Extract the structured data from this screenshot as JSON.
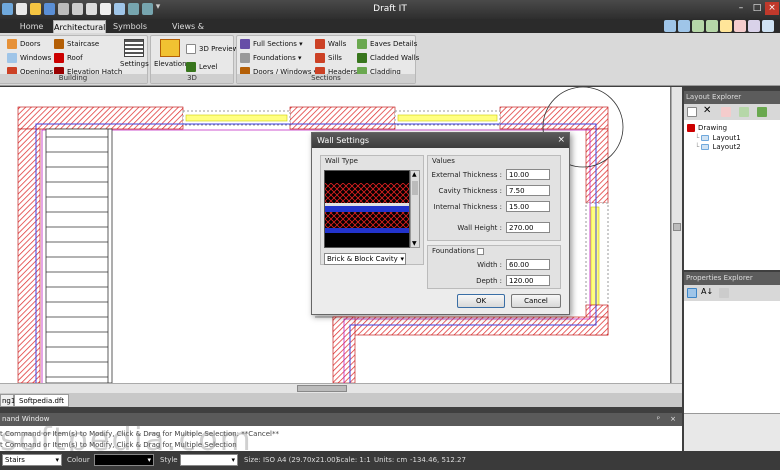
{
  "app_title": "Draft IT",
  "tabs": [
    "Home",
    "Architectural",
    "Symbols",
    "Views & Settings"
  ],
  "ribbon": {
    "building": {
      "caption": "Building",
      "doors": "Doors",
      "windows": "Windows",
      "openings": "Openings",
      "staircase": "Staircase",
      "roof": "Roof",
      "elevation_hatch": "Elevation Hatch",
      "settings": "Settings"
    },
    "three_d": {
      "caption": "3D",
      "elevation": "Elevation",
      "preview": "3D Preview",
      "level": "Level"
    },
    "sections": {
      "caption": "Sections",
      "full_sections": "Full Sections",
      "foundations": "Foundations",
      "doors_windows": "Doors / Windows",
      "walls": "Walls",
      "sills": "Sills",
      "headers": "Headers",
      "eaves_details": "Eaves Details",
      "cladded_walls": "Cladded Walls",
      "cladding": "Cladding"
    }
  },
  "dialog": {
    "title": "Wall Settings",
    "close": "×",
    "wall_type_legend": "Wall Type",
    "wall_type_value": "Brick & Block Cavity",
    "values_legend": "Values",
    "external_thickness_label": "External Thickness :",
    "external_thickness": "10.00",
    "cavity_thickness_label": "Cavity Thickness :",
    "cavity_thickness": "7.50",
    "internal_thickness_label": "Internal Thickness :",
    "internal_thickness": "15.00",
    "wall_height_label": "Wall Height :",
    "wall_height": "270.00",
    "foundations_legend": "Foundations",
    "width_label": "Width :",
    "width": "60.00",
    "depth_label": "Depth :",
    "depth": "120.00",
    "ok": "OK",
    "cancel": "Cancel"
  },
  "layout_explorer": {
    "title": "Layout Explorer",
    "root": "Drawing",
    "items": [
      "Layout1",
      "Layout2"
    ]
  },
  "properties_explorer": {
    "title": "Properties Explorer"
  },
  "doc_tabs": [
    "ng1",
    "Softpedia.dft"
  ],
  "command_window": {
    "title": "nand Window",
    "lines": [
      "t Command or Item(s) to Modify, Click & Drag for Multiple Selection: **Cancel**",
      "t Command or Item(s) to Modify, Click & Drag for Multiple Selection"
    ]
  },
  "status": {
    "layer": "Stairs",
    "colour_label": "Colour",
    "style_label": "Style",
    "size": "Size: ISO A4 (29.70x21.00)",
    "scale": "Scale: 1:1",
    "units": "Units: cm",
    "coords": "-134.46, 512.27"
  },
  "watermark": "softpedia.com",
  "colors": {
    "wall_hatch": "#e03030",
    "wall_inner": "#4040e0",
    "window": "#ffff80",
    "titlebar": "#3a3a3a"
  }
}
